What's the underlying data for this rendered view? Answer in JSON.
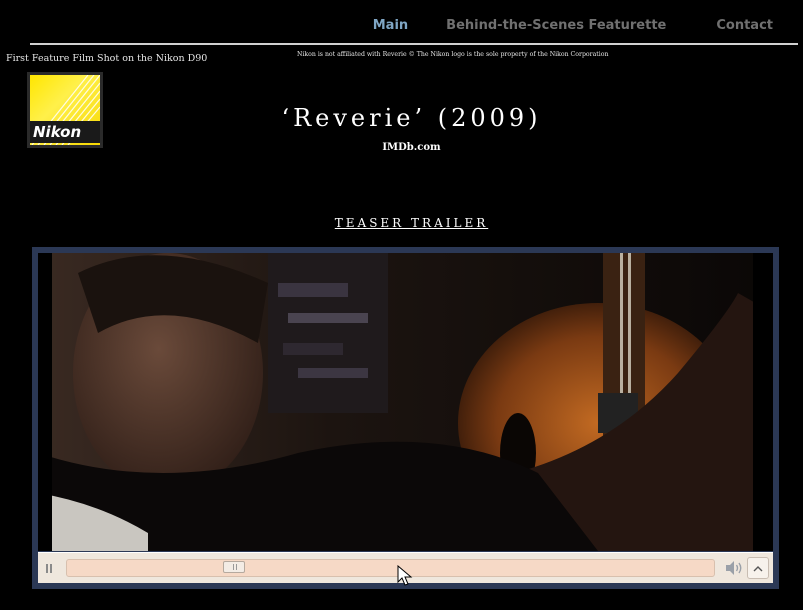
{
  "nav": {
    "items": [
      {
        "label": "Main",
        "active": true
      },
      {
        "label": "Behind-the-Scenes Featurette",
        "active": false
      },
      {
        "label": "Contact",
        "active": false
      }
    ],
    "active_color": "#7fa6c4",
    "inactive_color": "#707070"
  },
  "header": {
    "tagline": "First Feature Film Shot on the Nikon D90",
    "disclaimer": "Nikon is not affiliated with Reverie © The Nikon logo is the sole property of the Nikon Corporation"
  },
  "logo": {
    "wordmark": "Nikon"
  },
  "main": {
    "title": "‘Reverie’ (2009)",
    "imdb_link": "IMDb.com",
    "trailer_heading": "TEASER TRAILER"
  },
  "player": {
    "state": "playing",
    "progress": 0.25,
    "icons": [
      "pause-icon",
      "speaker-icon",
      "chevron-up-icon"
    ],
    "frame_color": "#2b3855",
    "control_bar_color": "#efe7dd",
    "seek_track_color": "#f6d9c6"
  }
}
